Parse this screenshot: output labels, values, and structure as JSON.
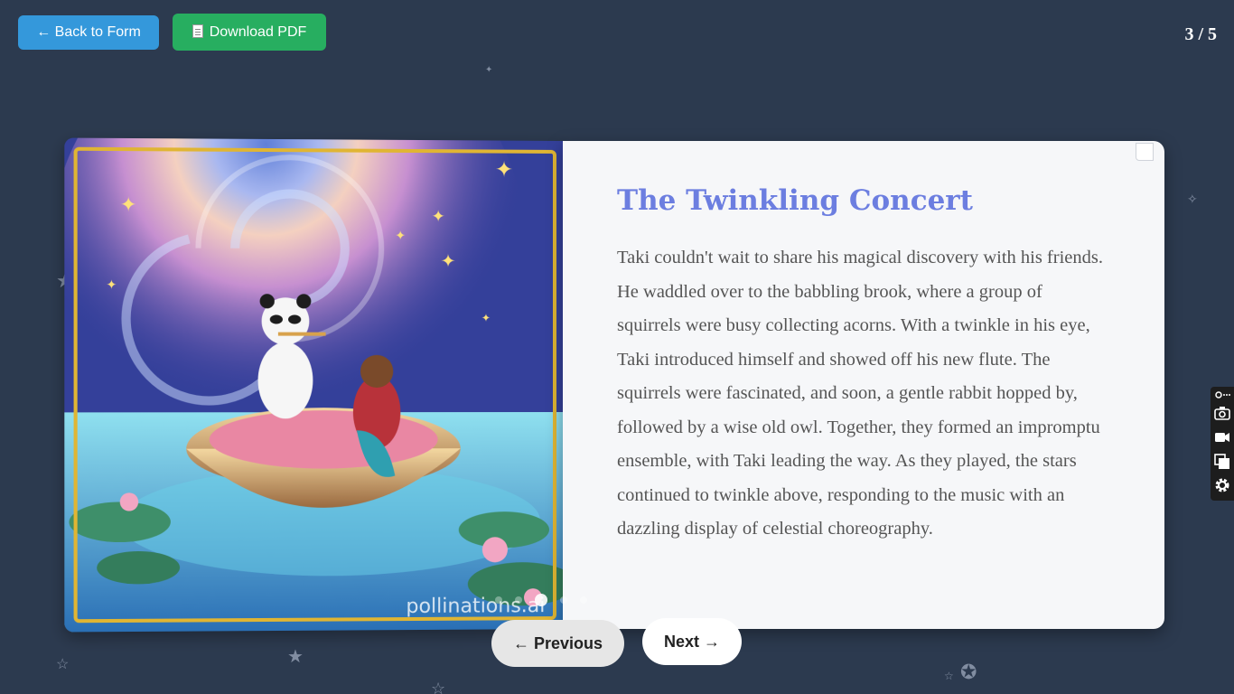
{
  "toolbar": {
    "back_label": "← Back to Form",
    "download_label": "Download PDF"
  },
  "page_counter": "3 / 5",
  "story": {
    "title": "The Twinkling Concert",
    "body": "Taki couldn't wait to share his magical discovery with his friends. He waddled over to the babbling brook, where a group of squirrels were busy collecting acorns. With a twinkle in his eye, Taki introduced himself and showed off his new flute. The squirrels were fascinated, and soon, a gentle rabbit hopped by, followed by a wise old owl. Together, they formed an impromptu ensemble, with Taki leading the way. As they played, the stars continued to twinkle above, responding to the music with an dazzling display of celestial choreography.",
    "watermark": "pollinations.ai"
  },
  "nav": {
    "prev_label": "← Previous",
    "next_label": "Next →"
  },
  "colors": {
    "background": "#2c3a4f",
    "back_button": "#3498db",
    "download_button": "#27ae60",
    "title": "#6c7ee0",
    "frame": "#e0b533"
  },
  "side_toolbar": {
    "icons": [
      "pin-icon",
      "camera-icon",
      "video-icon",
      "copy-icon",
      "gear-icon"
    ]
  }
}
